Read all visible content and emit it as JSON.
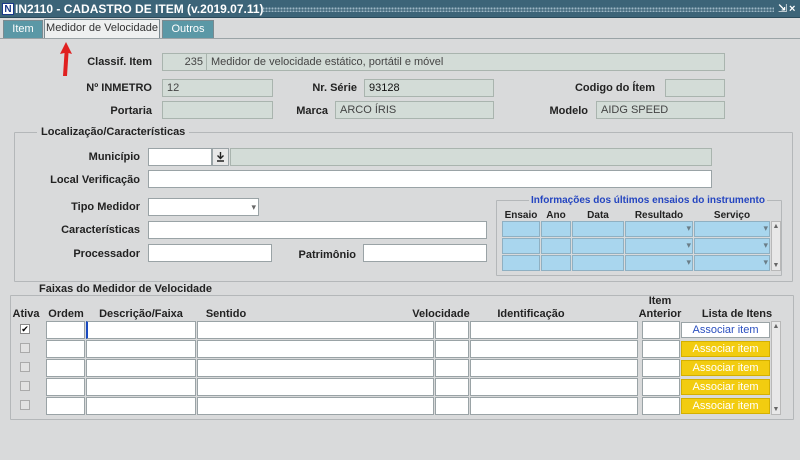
{
  "window": {
    "title": "IN2110 - CADASTRO DE ITEM (v.2019.07.11)",
    "icon_letter": "N",
    "controls": {
      "shrink": "⇲",
      "close": "×"
    }
  },
  "tabs": [
    {
      "label": "Item",
      "active": false
    },
    {
      "label": "Medidor de Velocidade",
      "active": true
    },
    {
      "label": "Outros",
      "active": false
    }
  ],
  "header": {
    "classif_label": "Classif. Item",
    "classif_code": "235",
    "classif_desc": "Medidor de velocidade estático, portátil e móvel",
    "inmetro_label": "Nº INMETRO",
    "inmetro_value": "12",
    "serie_label": "Nr. Série",
    "serie_value": "93128",
    "codigo_label": "Codigo do Ítem",
    "codigo_value": "",
    "portaria_label": "Portaria",
    "portaria_value": "",
    "marca_label": "Marca",
    "marca_value": "ARCO ÍRIS",
    "modelo_label": "Modelo",
    "modelo_value": "AIDG SPEED"
  },
  "localizacao": {
    "legend": "Localização/Características",
    "municipio_label": "Município",
    "municipio_value": "",
    "municipio_name": "",
    "local_label": "Local Verificação",
    "local_value": "",
    "tipo_label": "Tipo Medidor",
    "tipo_value": "",
    "caracteristicas_label": "Características",
    "caracteristicas_value": "",
    "processador_label": "Processador",
    "processador_value": "",
    "patrimonio_label": "Patrimônio",
    "patrimonio_value": "",
    "info": {
      "title": "Informações dos últimos ensaios do instrumento",
      "headers": [
        "Ensaio",
        "Ano",
        "Data",
        "Resultado",
        "Serviço"
      ]
    }
  },
  "faixas": {
    "legend": "Faixas do Medidor de Velocidade",
    "headers": {
      "ativa": "Ativa",
      "ordem": "Ordem",
      "descricao": "Descrição/Faixa",
      "sentido": "Sentido",
      "velocidade": "Velocidade",
      "identificacao": "Identificação",
      "item_anterior_1": "Item",
      "item_anterior_2": "Anterior",
      "lista": "Lista de Itens"
    },
    "rows": [
      {
        "ativa": true,
        "enabled": true,
        "assoc_label": "Associar item"
      },
      {
        "ativa": false,
        "enabled": false,
        "assoc_label": "Associar item"
      },
      {
        "ativa": false,
        "enabled": false,
        "assoc_label": "Associar item"
      },
      {
        "ativa": false,
        "enabled": false,
        "assoc_label": "Associar item"
      },
      {
        "ativa": false,
        "enabled": false,
        "assoc_label": "Associar item"
      }
    ]
  },
  "colors": {
    "titlebar": "#3c6478",
    "tab_inactive": "#5b98a6",
    "readonly_field": "#d3dcd7",
    "grid_blue": "#a9d6ee",
    "assoc_disabled": "#f2cc10",
    "annotation_arrow": "#e02020"
  }
}
